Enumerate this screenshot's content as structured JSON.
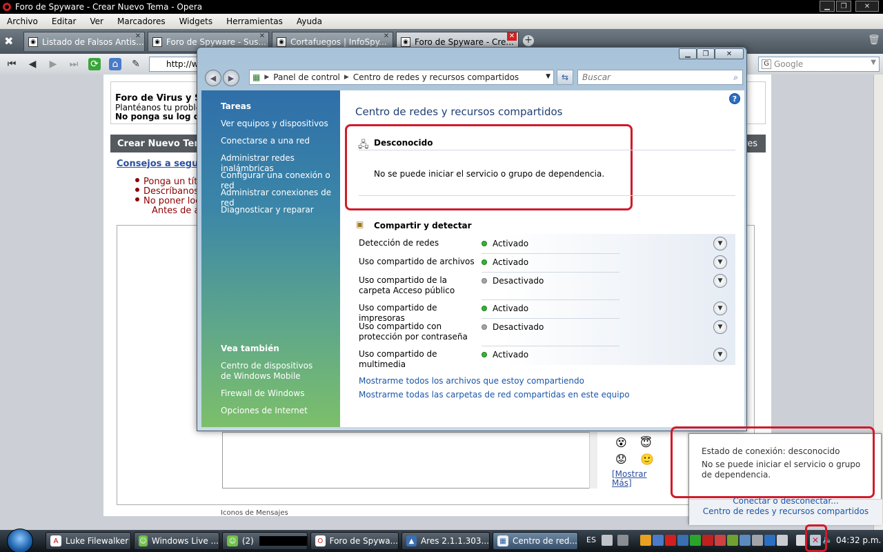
{
  "opera": {
    "title": "Foro de Spyware - Crear Nuevo Tema - Opera",
    "menu": [
      "Archivo",
      "Editar",
      "Ver",
      "Marcadores",
      "Widgets",
      "Herramientas",
      "Ayuda"
    ],
    "tabs": [
      {
        "label": "Listado de Falsos Antis..."
      },
      {
        "label": "Foro de Spyware - Sus..."
      },
      {
        "label": "Cortafuegos | InfoSpy..."
      },
      {
        "label": "Foro de Spyware - Cre..."
      }
    ],
    "url_text": "http://w",
    "search_placeholder": "Google"
  },
  "forum": {
    "header_title": "Foro de Virus y Sp",
    "header_line2": "Plantéanos tu proble",
    "header_line3": "No ponga su log de",
    "section_title": "Crear Nuevo Tem",
    "right_tab": "res",
    "advice_link": "Consejos a segui",
    "bullets": [
      "Ponga un tít",
      "Descríbanos",
      "No poner loc",
      "Antes de a"
    ],
    "show_more": "[Mostrar Más]",
    "icons_label": "Iconos de Mensajes"
  },
  "cp": {
    "breadcrumb": [
      "Panel de control",
      "Centro de redes y recursos compartidos"
    ],
    "search_placeholder": "Buscar",
    "title": "Centro de redes y recursos compartidos",
    "sidebar": {
      "tasks_heading": "Tareas",
      "tasks": [
        "Ver equipos y dispositivos",
        "Conectarse a una red",
        "Administrar redes inalámbricas",
        "Configurar una conexión o red",
        "Administrar conexiones de red",
        "Diagnosticar y reparar"
      ],
      "see_also_heading": "Vea también",
      "see_also": [
        "Centro de dispositivos de Windows Mobile",
        "Firewall de Windows",
        "Opciones de Internet"
      ]
    },
    "network": {
      "name": "Desconocido",
      "message": "No se puede iniciar el servicio o grupo de dependencia."
    },
    "sharing": {
      "heading": "Compartir y detectar",
      "rows": [
        {
          "label": "Detección de redes",
          "status": "Activado",
          "on": true
        },
        {
          "label": "Uso compartido de archivos",
          "status": "Activado",
          "on": true
        },
        {
          "label": "Uso compartido de la carpeta Acceso público",
          "status": "Desactivado",
          "on": false
        },
        {
          "label": "Uso compartido de impresoras",
          "status": "Activado",
          "on": true
        },
        {
          "label": "Uso compartido con protección por contraseña",
          "status": "Desactivado",
          "on": false
        },
        {
          "label": "Uso compartido de multimedia",
          "status": "Activado",
          "on": true
        }
      ]
    },
    "links": [
      "Mostrarme todos los archivos que estoy compartiendo",
      "Mostrarme todas las carpetas de red compartidas en este equipo"
    ]
  },
  "balloon": {
    "title": "Estado de conexión: desconocido",
    "message": "No se puede iniciar el servicio o grupo de dependencia.",
    "link1": "Conectar o desconectar...",
    "link2": "Centro de redes y recursos compartidos"
  },
  "taskbar": {
    "tasks": [
      {
        "label": "Luke Filewalker"
      },
      {
        "label": "Windows Live ..."
      },
      {
        "label": "(2)"
      },
      {
        "label": "Foro de Spywa..."
      },
      {
        "label": "Ares 2.1.1.303..."
      },
      {
        "label": "Centro de red..."
      }
    ],
    "lang": "ES",
    "clock": "04:32 p.m."
  },
  "colors": {
    "highlight_red": "#d01a2a",
    "link_blue": "#1a55a8",
    "status_on": "#35b535"
  }
}
